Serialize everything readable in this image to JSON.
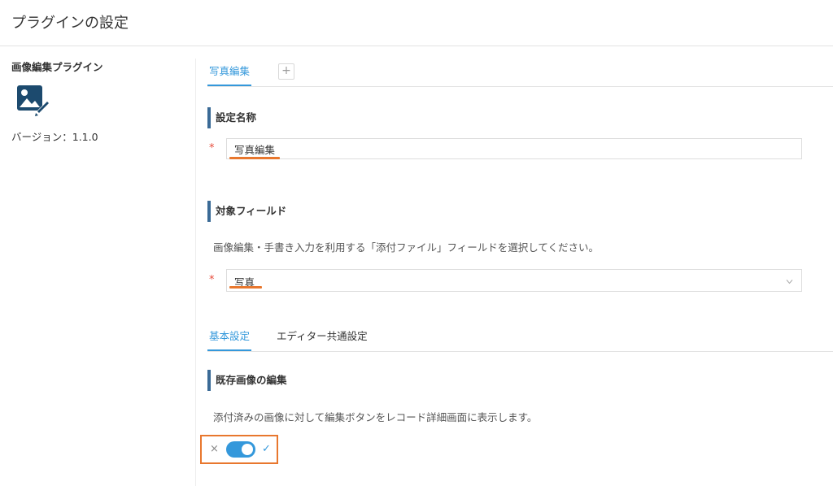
{
  "page": {
    "title": "プラグインの設定"
  },
  "sidebar": {
    "plugin_name": "画像編集プラグイン",
    "plugin_icon": "image-edit-icon",
    "version": "バージョン：1.1.0"
  },
  "top_tabs": {
    "active_tab": "写真編集",
    "add_tab_icon": "+"
  },
  "setting_name": {
    "label": "設定名称",
    "required": "*",
    "value": "写真編集"
  },
  "target_field": {
    "label": "対象フィールド",
    "description": "画像編集・手書き入力を利用する「添付ファイル」フィールドを選択してください。",
    "required": "*",
    "selected": "写真"
  },
  "settings_tabs": {
    "basic": "基本設定",
    "editor_common": "エディター共通設定"
  },
  "existing_image": {
    "label": "既存画像の編集",
    "description": "添付済みの画像に対して編集ボタンをレコード詳細画面に表示します。",
    "toggle_off_icon": "×",
    "toggle_on_icon": "✓",
    "enabled": true
  },
  "colors": {
    "accent": "#3498db",
    "highlight": "#e8772e",
    "section_bar": "#3a6a96",
    "required": "#e74c3c",
    "icon": "#1c4a6e"
  }
}
